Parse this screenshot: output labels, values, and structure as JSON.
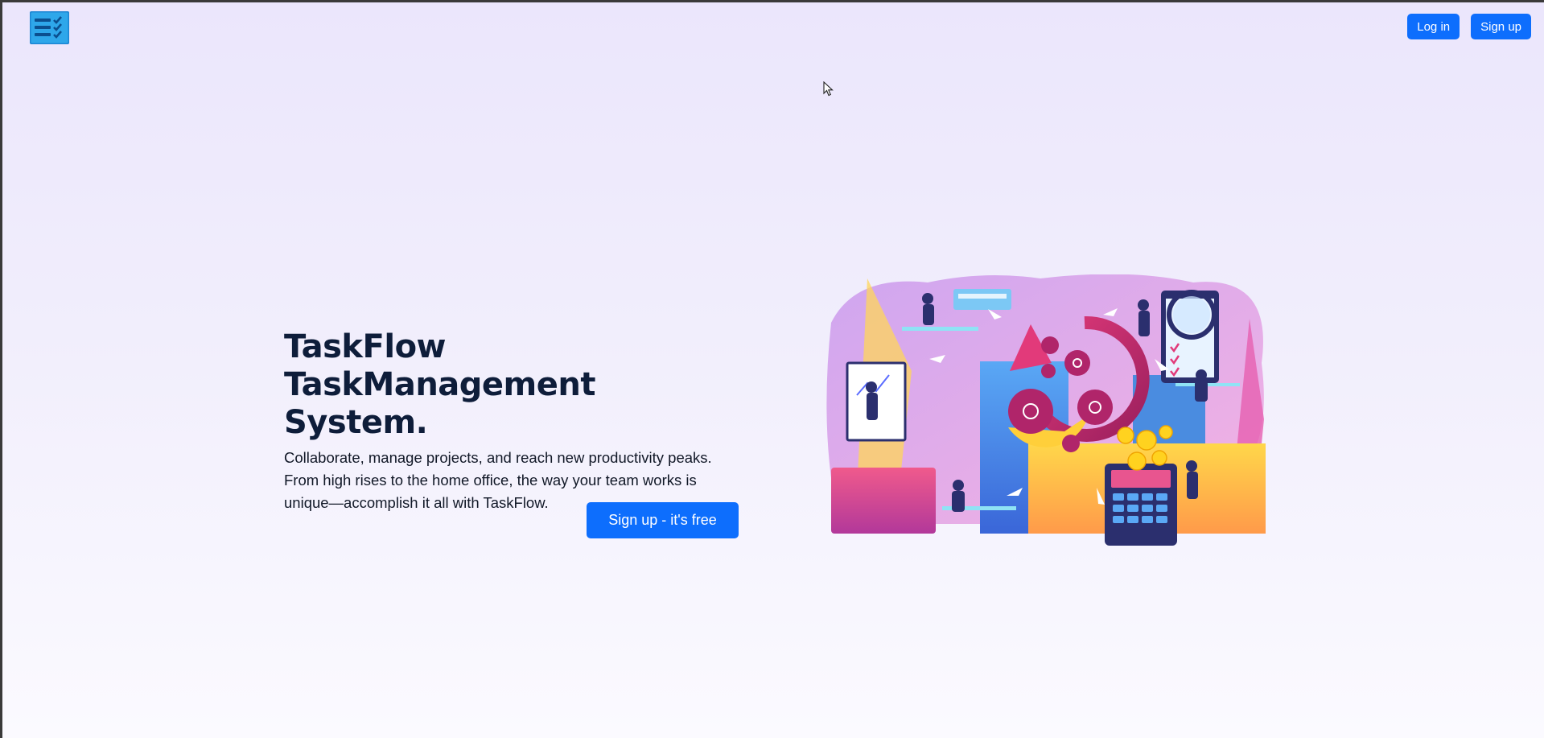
{
  "header": {
    "logo_icon": "taskflow-checklist-logo-icon",
    "login_label": "Log in",
    "signup_label": "Sign up"
  },
  "hero": {
    "title": "TaskFlow TaskManagement System.",
    "description": "Collaborate, manage projects, and reach new productivity peaks. From high rises to the home office, the way your team works is unique—accomplish it all with TaskFlow.",
    "cta_label": "Sign up - it's free",
    "illustration_icon": "team-productivity-illustration"
  },
  "colors": {
    "primary": "#0d6efd",
    "title": "#0e1d3a",
    "background_top": "#ebe6fc",
    "background_bottom": "#fbfaff"
  }
}
